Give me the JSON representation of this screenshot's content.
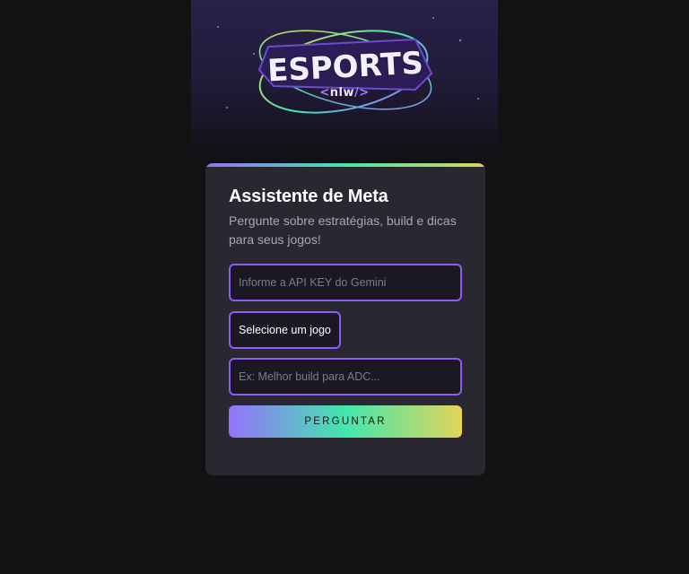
{
  "hero": {
    "logo_text": "ESPORTS",
    "logo_sub": {
      "left": "<",
      "text": "nlw",
      "right": "/>"
    }
  },
  "card": {
    "title": "Assistente de Meta",
    "subtitle": "Pergunte sobre estratégias, build e dicas para seus jogos!",
    "api_key": {
      "value": "",
      "placeholder": "Informe a API KEY do Gemini"
    },
    "game_select": {
      "selected": "Selecione um jogo"
    },
    "question": {
      "value": "",
      "placeholder": "Ex: Melhor build para ADC..."
    },
    "submit_label": "PERGUNTAR"
  },
  "colors": {
    "background": "#121214",
    "card": "#29272f",
    "accent_purple": "#8b5cf6",
    "gradient": [
      "#9572fc",
      "#43e7ad",
      "#e2d45c"
    ]
  }
}
